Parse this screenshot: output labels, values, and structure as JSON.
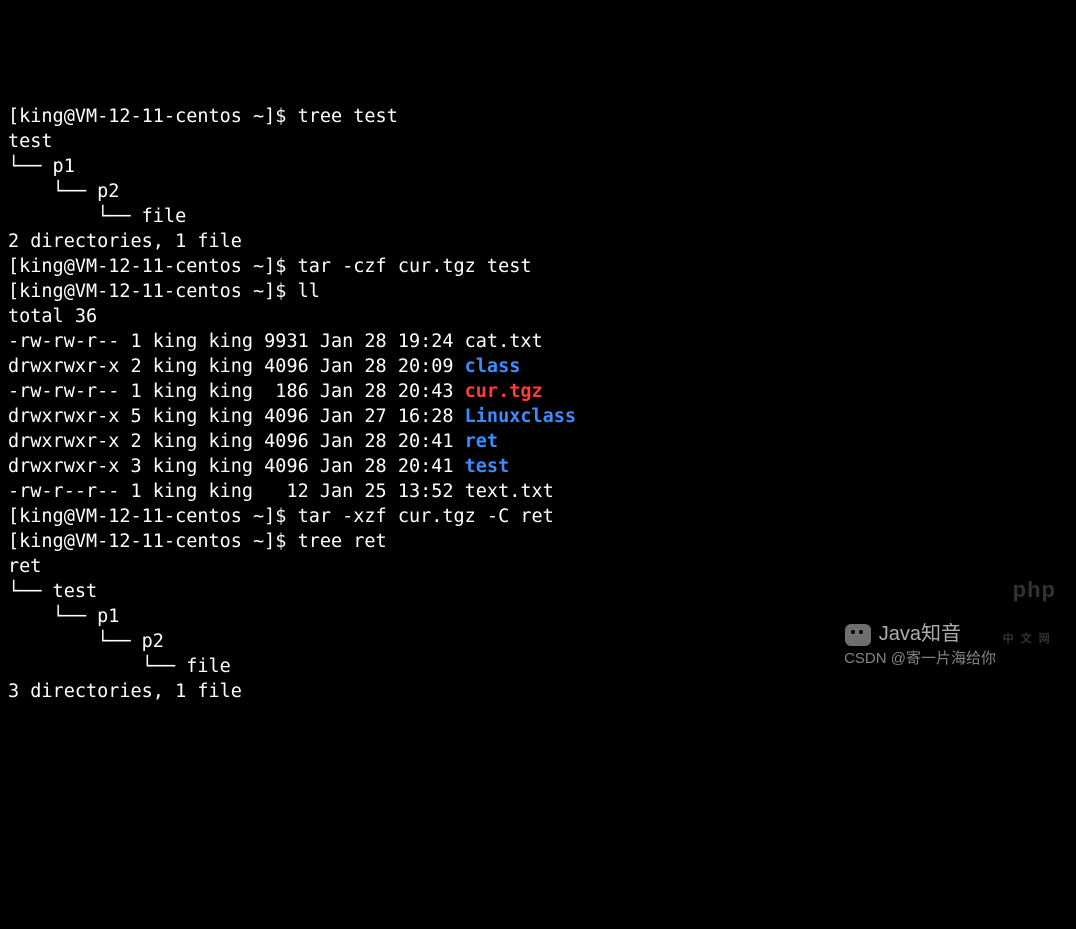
{
  "prompt": "[king@VM-12-11-centos ~]$",
  "cmds": {
    "tree_test": "tree test",
    "tar_czf": "tar -czf cur.tgz test",
    "ll": "ll",
    "tar_xzf": "tar -xzf cur.tgz -C ret",
    "tree_ret": "tree ret"
  },
  "tree1": {
    "root": "test",
    "l1": "└── p1",
    "l2": "    └── p2",
    "l3": "        └── file",
    "summary": "2 directories, 1 file"
  },
  "ll": {
    "total": "total 36",
    "rows": [
      {
        "perm": "-rw-rw-r--",
        "n": "1",
        "u": "king",
        "g": "king",
        "size": "9931",
        "date": "Jan 28 19:24",
        "name": "cat.txt",
        "cls": ""
      },
      {
        "perm": "drwxrwxr-x",
        "n": "2",
        "u": "king",
        "g": "king",
        "size": "4096",
        "date": "Jan 28 20:09",
        "name": "class",
        "cls": "blue"
      },
      {
        "perm": "-rw-rw-r--",
        "n": "1",
        "u": "king",
        "g": "king",
        "size": " 186",
        "date": "Jan 28 20:43",
        "name": "cur.tgz",
        "cls": "red"
      },
      {
        "perm": "drwxrwxr-x",
        "n": "5",
        "u": "king",
        "g": "king",
        "size": "4096",
        "date": "Jan 27 16:28",
        "name": "Linuxclass",
        "cls": "blue"
      },
      {
        "perm": "drwxrwxr-x",
        "n": "2",
        "u": "king",
        "g": "king",
        "size": "4096",
        "date": "Jan 28 20:41",
        "name": "ret",
        "cls": "blue"
      },
      {
        "perm": "drwxrwxr-x",
        "n": "3",
        "u": "king",
        "g": "king",
        "size": "4096",
        "date": "Jan 28 20:41",
        "name": "test",
        "cls": "blue"
      },
      {
        "perm": "-rw-r--r--",
        "n": "1",
        "u": "king",
        "g": "king",
        "size": "  12",
        "date": "Jan 25 13:52",
        "name": "text.txt",
        "cls": ""
      }
    ]
  },
  "tree2": {
    "root": "ret",
    "l1": "└── test",
    "l2": "    └── p1",
    "l3": "        └── p2",
    "l4": "            └── file",
    "summary": "3 directories, 1 file"
  },
  "watermarks": {
    "php": "php",
    "php_sub": "中 文 网",
    "wx": "Java知音",
    "csdn": "CSDN @寄一片海给你"
  }
}
